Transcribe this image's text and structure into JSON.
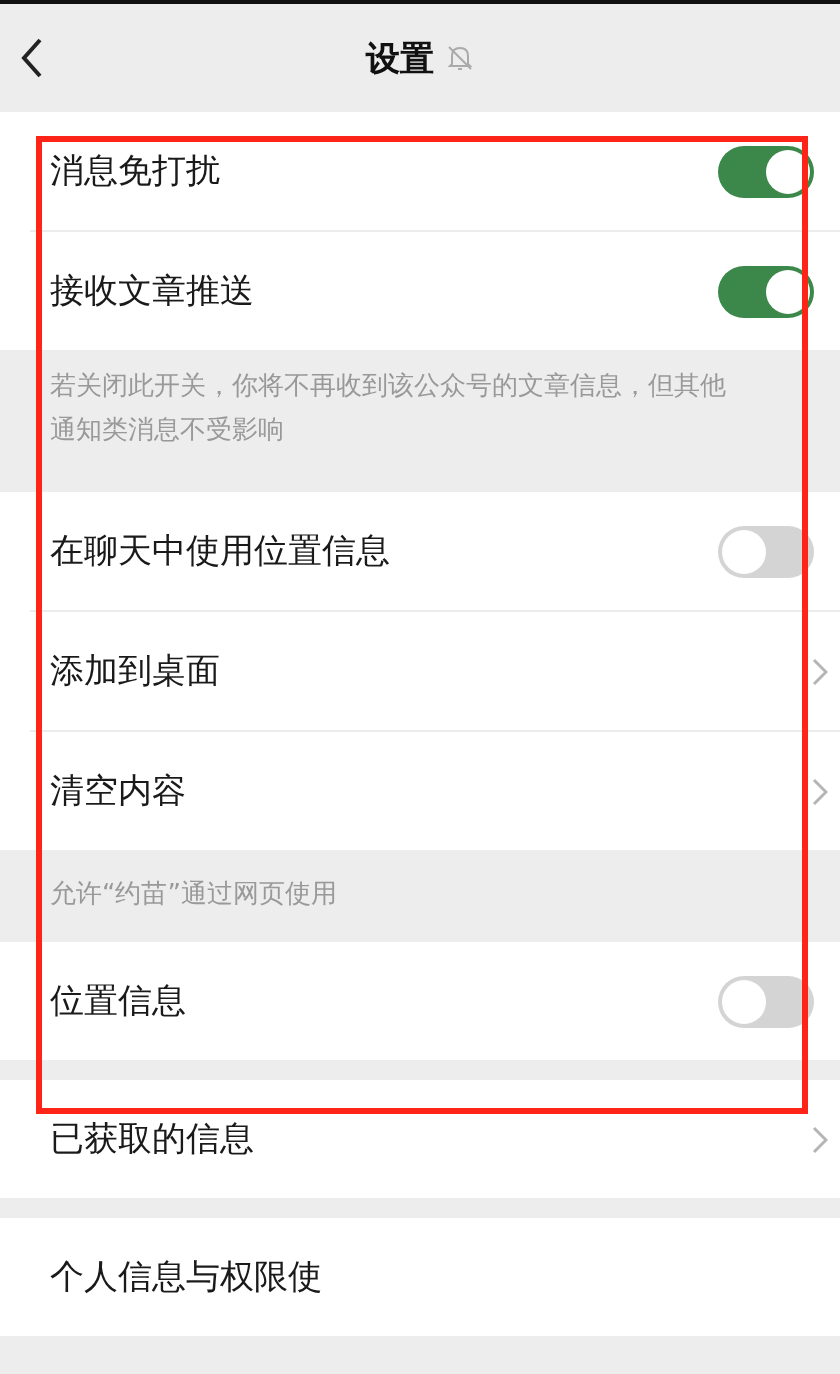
{
  "nav_bar": {
    "title": "设置"
  },
  "groups": [
    {
      "items": [
        {
          "kind": "toggle",
          "label": "消息免打扰",
          "on": true
        },
        {
          "kind": "toggle",
          "label": "接收文章推送",
          "on": true
        }
      ],
      "note": "若关闭此开关，你将不再收到该公众号的文章信息，但其他通知类消息不受影响"
    },
    {
      "items": [
        {
          "kind": "toggle",
          "label": "在聊天中使用位置信息",
          "on": false
        },
        {
          "kind": "link",
          "label": "添加到桌面"
        },
        {
          "kind": "link",
          "label": "清空内容"
        }
      ]
    },
    {
      "header": "允许“约苗”通过网页使用",
      "items": [
        {
          "kind": "toggle",
          "label": "位置信息",
          "on": false
        }
      ]
    },
    {
      "items": [
        {
          "kind": "link",
          "label": "已获取的信息"
        }
      ]
    },
    {
      "items": [
        {
          "kind": "text",
          "label": "个人信息与权限使"
        }
      ]
    }
  ],
  "annotations": [
    {
      "kind": "frame"
    }
  ]
}
